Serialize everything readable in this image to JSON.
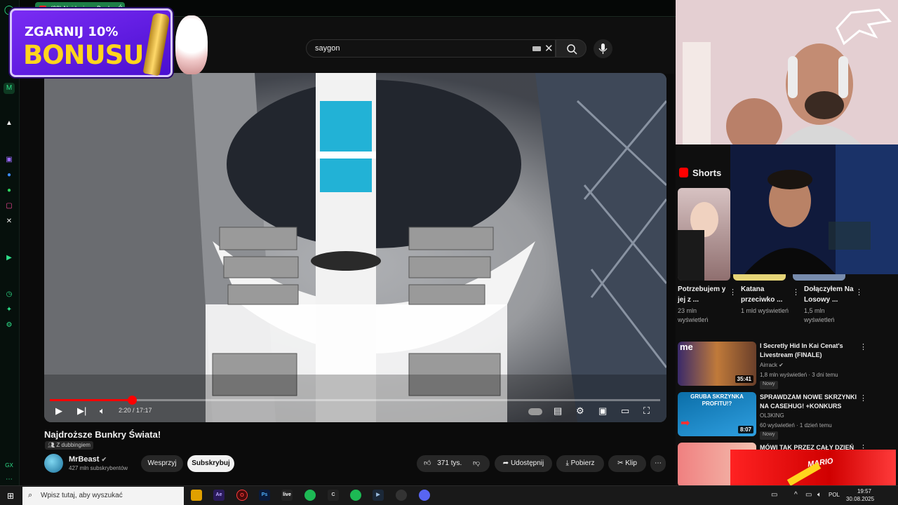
{
  "browser": {
    "tab_title": "(38) Najdroższe Bunkry Ś"
  },
  "ad": {
    "line1": "ZGARNIJ 10%",
    "line2": "BONUSU"
  },
  "search": {
    "value": "saygon"
  },
  "player": {
    "time": "2:20 / 17:17",
    "progress": 0.135
  },
  "video": {
    "title": "Najdroższe Bunkry Świata!",
    "dub_label": "Z dubbingiem",
    "channel": "MrBeast",
    "subscribers": "427 mln subskrybentów",
    "support_label": "Wesprzyj",
    "subscribe_label": "Subskrybuj",
    "likes": "371 tys.",
    "share_label": "Udostępnij",
    "download_label": "Pobierz",
    "clip_label": "Klip"
  },
  "shorts": {
    "heading": "Shorts",
    "items": [
      {
        "title": "Potrzebujem y jej z ...",
        "views": "23 mln wyświetleń"
      },
      {
        "title": "Katana przeciwko ...",
        "views": "1 mld wyświetleń"
      },
      {
        "title": "Dołączyłem Na Losowy ...",
        "views": "1,5 mln wyświetleń"
      }
    ]
  },
  "recommended": [
    {
      "title": "I Secretly Hid In Kai Cenat's Livestream (FINALE)",
      "channel": "Airrack",
      "meta": "1,8 mln wyświetleń · 3 dni temu",
      "badge": "Nowy",
      "duration": "35:41",
      "thumb_text": "me"
    },
    {
      "title": "SPRAWDZAM NOWE SKRZYNKI NA CASEHUG! +KONKURS",
      "channel": "OL3KING",
      "meta": "60 wyświetleń · 1 dzień temu",
      "badge": "Nowy",
      "duration": "8:07",
      "thumb_text": "GRUBA SKRZYNKA PROFITU!?"
    },
    {
      "title": "MÓWI TAK PRZEZ CAŁY DZIEŃ",
      "channel": "",
      "meta": "",
      "badge": "",
      "duration": "",
      "thumb_text": ""
    }
  ],
  "overlay": {
    "mario_label": "MARIO"
  },
  "taskbar": {
    "search_placeholder": "Wpisz tutaj, aby wyszukać",
    "lang": "POL",
    "time": "19:57",
    "date": "30.08.2025"
  },
  "colors": {
    "accent": "#ff0000",
    "opera_green": "#2ee08a",
    "ad_purple": "#6a20e8",
    "ad_yellow": "#ffd51d"
  }
}
